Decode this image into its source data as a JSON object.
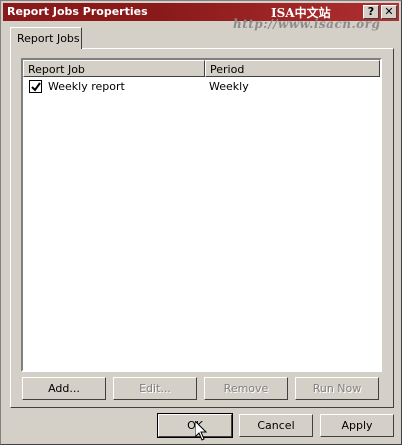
{
  "window": {
    "title": "Report Jobs Properties",
    "watermark": "ISA中文站",
    "watermark_url": "http://www.isacn.org",
    "help_glyph": "?",
    "close_glyph": "✕"
  },
  "tabs": [
    {
      "label": "Report Jobs",
      "selected": true
    }
  ],
  "list": {
    "columns": [
      "Report Job",
      "Period"
    ],
    "rows": [
      {
        "checked": true,
        "job": "Weekly report",
        "period": "Weekly"
      }
    ]
  },
  "buttons": {
    "add": "Add...",
    "edit": "Edit...",
    "remove": "Remove",
    "run_now": "Run Now",
    "ok": "OK",
    "cancel": "Cancel",
    "apply": "Apply"
  },
  "colors": {
    "titlebar": "#8a1a1a",
    "face": "#d4d0c8",
    "disabled_text": "#808080"
  }
}
